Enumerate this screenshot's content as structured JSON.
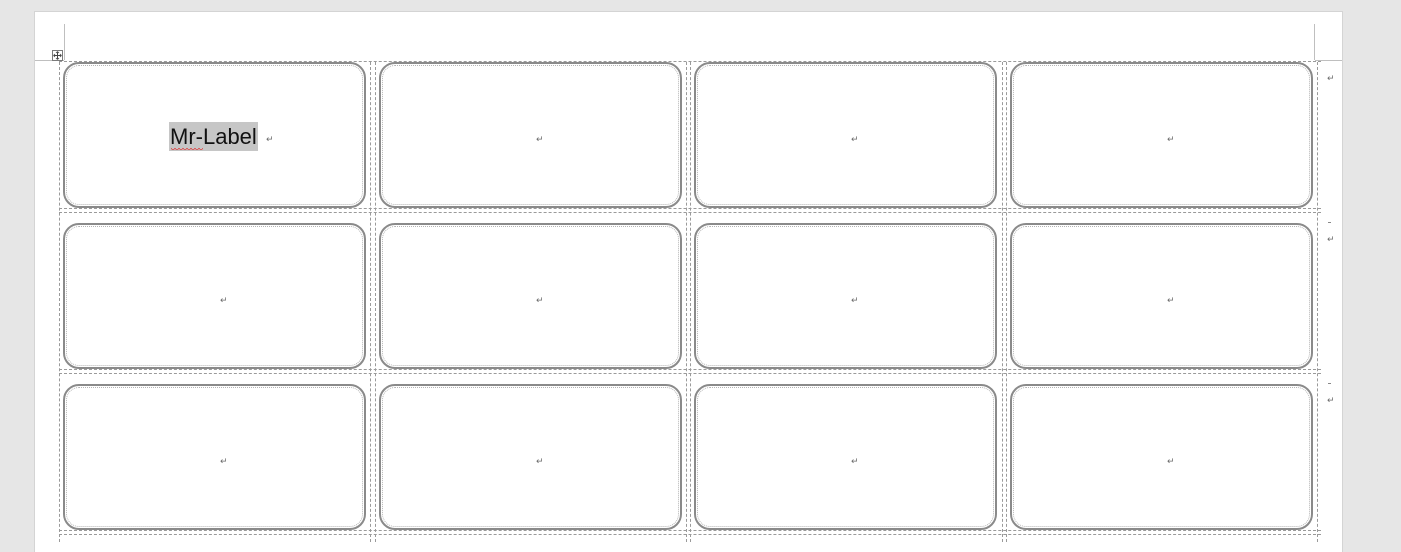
{
  "document": {
    "labels": [
      {
        "text": "Mr-Label",
        "mark": "↵"
      },
      {
        "text": "",
        "mark": "↵"
      },
      {
        "text": "",
        "mark": "↵"
      },
      {
        "text": "",
        "mark": "↵"
      },
      {
        "text": "",
        "mark": "↵"
      },
      {
        "text": "",
        "mark": "↵"
      },
      {
        "text": "",
        "mark": "↵"
      },
      {
        "text": "",
        "mark": "↵"
      },
      {
        "text": "",
        "mark": "↵"
      },
      {
        "text": "",
        "mark": "↵"
      },
      {
        "text": "",
        "mark": "↵"
      },
      {
        "text": "",
        "mark": "↵"
      }
    ],
    "row_end_marks": [
      "↵",
      "↵",
      "↵"
    ],
    "move_handle_icon": "table-move-icon",
    "spellcheck_color": "#e03030",
    "selection_color": "#c6c6c6"
  }
}
